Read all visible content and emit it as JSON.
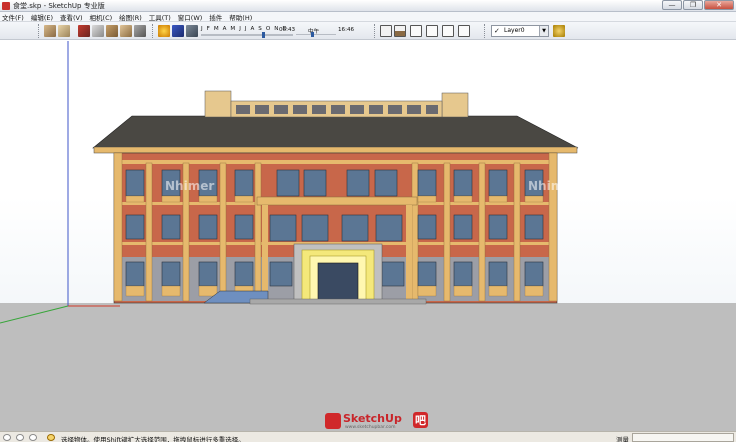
{
  "window": {
    "title": "食堂.skp - SketchUp 专业版",
    "controls": {
      "minimize": "—",
      "maximize": "❐",
      "close": "✕"
    }
  },
  "menu": [
    "文件(F)",
    "编辑(E)",
    "查看(V)",
    "相机(C)",
    "绘图(R)",
    "工具(T)",
    "窗口(W)",
    "插件",
    "帮助(H)"
  ],
  "toolbar": {
    "shadow_months": "J F M A M J J A S O N D",
    "shadow_month_fraction": 0.68,
    "time_start": "06:43",
    "time_noon": "中午",
    "time_end": "16:46",
    "time_fraction": 0.4,
    "layer": "Layer0",
    "layer_check": "✓"
  },
  "watermarks": {
    "left": "Nhimer",
    "right": "Nhimer"
  },
  "logo": {
    "text_sketch": "SketchUp",
    "text_badge": "吧",
    "url": "www.sketchupbar.com"
  },
  "statusbar": {
    "hint": "选择物体。使用Shift键扩大选择范围，拖拽鼠标进行多重选择。",
    "measure_label": "测量"
  },
  "colors": {
    "brick": "#c8674a",
    "sand_stone": "#e6b96d",
    "roof": "#4a4843",
    "window_glass": "#5b7694",
    "entrance_glow": "#f4e87a",
    "ground": "#bebebe",
    "sky": "#ffffff",
    "axis_green": "#37a53a",
    "axis_red": "#d03a2a",
    "axis_blue": "#3f56c8"
  }
}
